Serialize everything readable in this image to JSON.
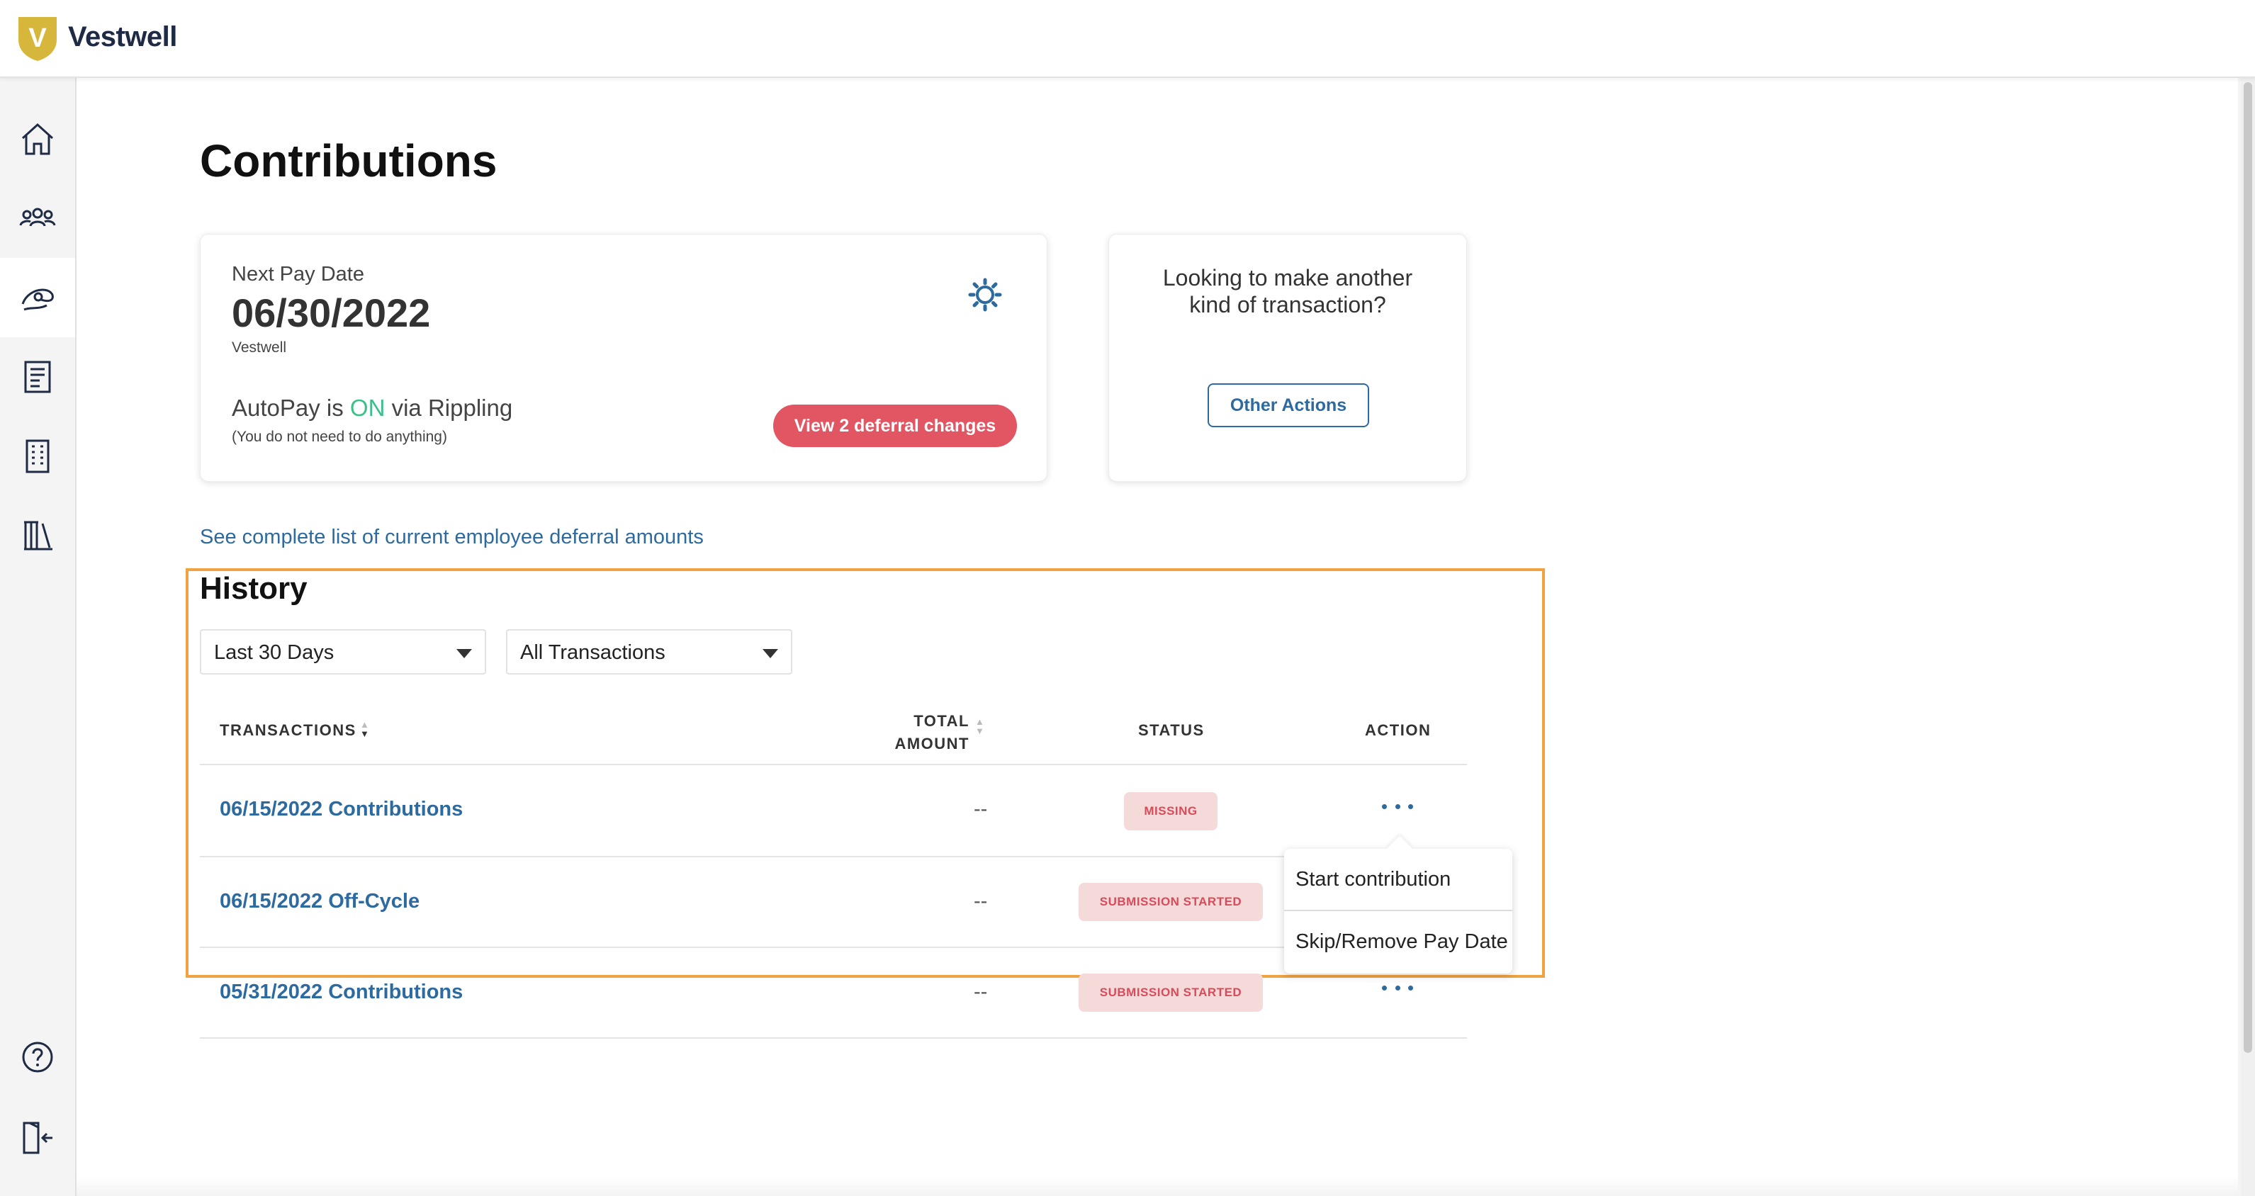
{
  "brand": {
    "name": "Vestwell",
    "logo_letter": "V"
  },
  "sidebar": {
    "items": [
      {
        "icon": "home-icon"
      },
      {
        "icon": "people-icon"
      },
      {
        "icon": "contributions-icon",
        "active": true
      },
      {
        "icon": "document-icon"
      },
      {
        "icon": "building-icon"
      },
      {
        "icon": "library-icon"
      }
    ],
    "bottom": [
      {
        "icon": "help-icon"
      },
      {
        "icon": "logout-icon"
      }
    ]
  },
  "page": {
    "title": "Contributions"
  },
  "pay_card": {
    "next_label": "Next Pay Date",
    "date": "06/30/2022",
    "company": "Vestwell",
    "autopay_prefix": "AutoPay is ",
    "autopay_state": "ON",
    "autopay_suffix": " via Rippling",
    "autopay_note": "(You do not need to do anything)",
    "deferral_button": "View 2 deferral changes"
  },
  "other_card": {
    "question_line1": "Looking to make another",
    "question_line2": "kind of transaction?",
    "button": "Other Actions"
  },
  "deferral_link": "See complete list of current employee deferral amounts",
  "history": {
    "title": "History",
    "filters": {
      "period": "Last 30 Days",
      "type": "All Transactions"
    },
    "columns": {
      "transactions": "TRANSACTIONS",
      "total_line1": "TOTAL",
      "total_line2": "AMOUNT",
      "status": "STATUS",
      "action": "ACTION"
    },
    "rows": [
      {
        "name": "06/15/2022 Contributions",
        "amount": "--",
        "status": "MISSING"
      },
      {
        "name": "06/15/2022 Off-Cycle",
        "amount": "--",
        "status": "SUBMISSION STARTED"
      },
      {
        "name": "05/31/2022 Contributions",
        "amount": "--",
        "status": "SUBMISSION STARTED"
      }
    ],
    "action_menu": {
      "items": [
        "Start contribution",
        "Skip/Remove Pay Date"
      ]
    }
  },
  "colors": {
    "accent": "#2d6a9f",
    "danger": "#e25563",
    "on": "#3cc08a",
    "highlight": "#f0a342",
    "brand": "#d6b73c"
  }
}
